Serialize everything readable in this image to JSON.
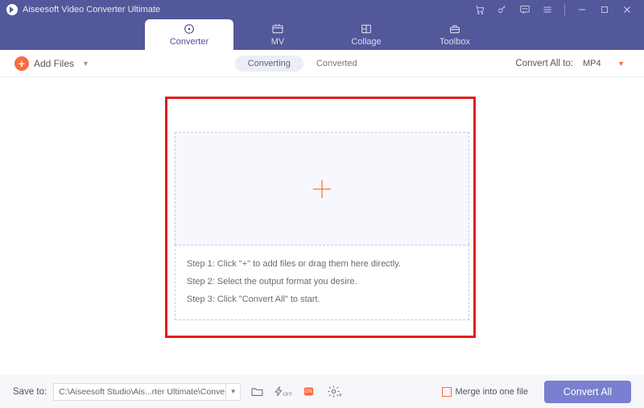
{
  "app": {
    "title": "Aiseesoft Video Converter Ultimate"
  },
  "tabs": {
    "converter": "Converter",
    "mv": "MV",
    "collage": "Collage",
    "toolbox": "Toolbox"
  },
  "toolbar": {
    "add_files": "Add Files",
    "converting": "Converting",
    "converted": "Converted",
    "convert_all_to_label": "Convert All to:",
    "format_selected": "MP4"
  },
  "dropzone": {
    "step1": "Step 1: Click \"+\" to add files or drag them here directly.",
    "step2": "Step 2: Select the output format you desire.",
    "step3": "Step 3: Click \"Convert All\" to start."
  },
  "bottom": {
    "save_to_label": "Save to:",
    "save_path": "C:\\Aiseesoft Studio\\Ais...rter Ultimate\\Converted",
    "merge_label": "Merge into one file",
    "convert_all_btn": "Convert All"
  }
}
